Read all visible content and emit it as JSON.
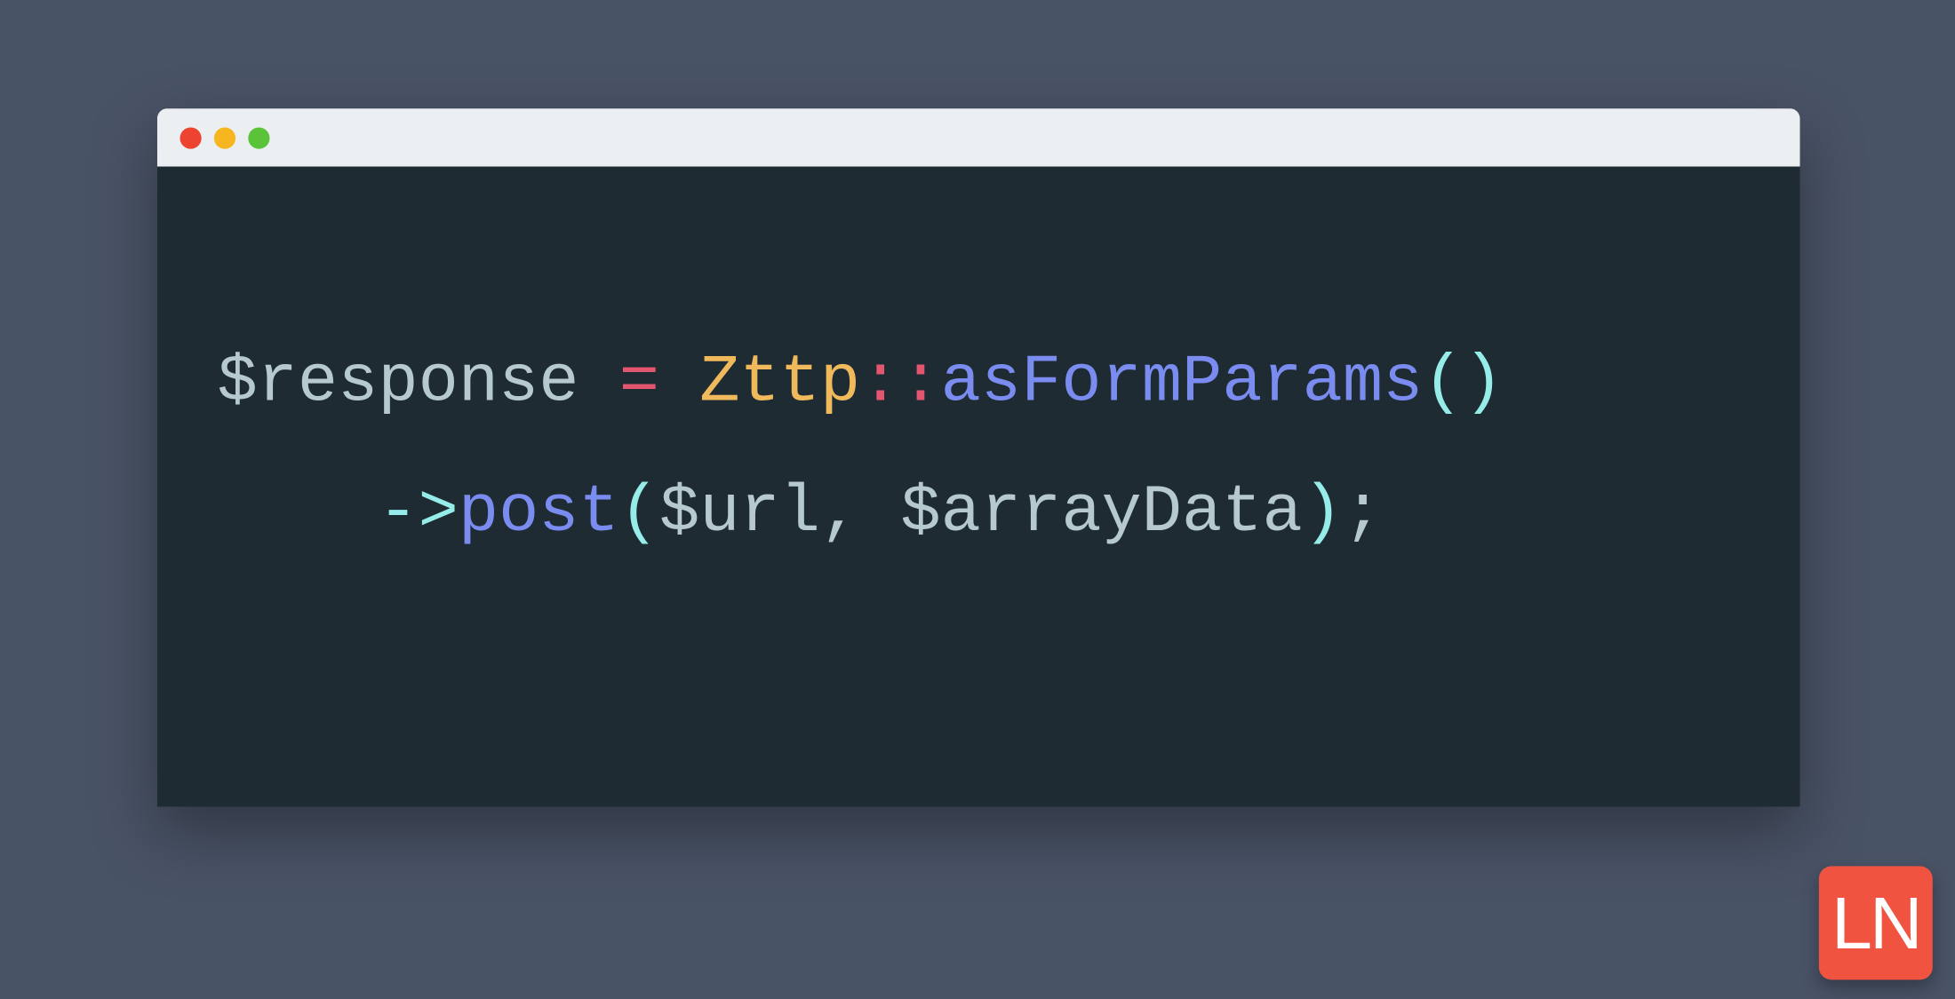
{
  "window": {
    "titlebar": {
      "close": "●",
      "minimize": "●",
      "zoom": "●"
    }
  },
  "code": {
    "line1": {
      "var": "$response",
      "sp1": " ",
      "eq": "=",
      "sp2": " ",
      "cls": "Zttp",
      "scope": "::",
      "fn": "asFormParams",
      "paren_open": "(",
      "paren_close": ")"
    },
    "line2": {
      "indent": "    ",
      "arrow": "->",
      "fn": "post",
      "paren_open": "(",
      "arg1": "$url",
      "comma": ",",
      "sp": " ",
      "arg2": "$arrayData",
      "paren_close": ")",
      "semi": ";"
    }
  },
  "logo": {
    "text": "LN"
  }
}
